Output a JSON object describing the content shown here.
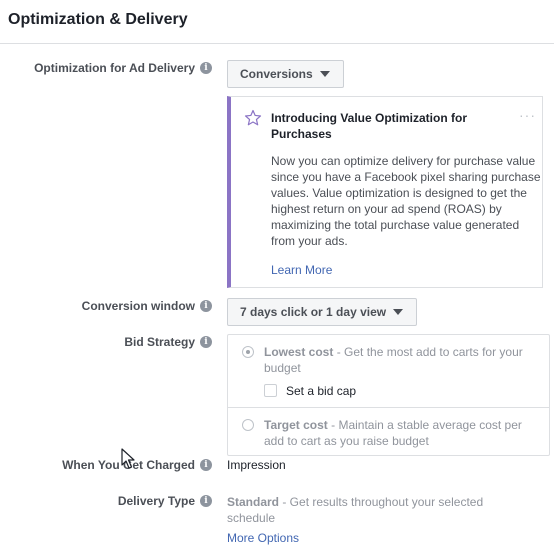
{
  "header": {
    "title": "Optimization & Delivery"
  },
  "optimization": {
    "label": "Optimization for Ad Delivery",
    "value": "Conversions"
  },
  "callout": {
    "title": "Introducing Value Optimization for Purchases",
    "body": "Now you can optimize delivery for purchase value since you have a Facebook pixel sharing purchase values. Value optimization is designed to get the highest return on your ad spend (ROAS) by maximizing the total purchase value generated from your ads.",
    "link": "Learn More",
    "more": "···",
    "icon": "star-icon"
  },
  "conversion_window": {
    "label": "Conversion window",
    "value": "7 days click or 1 day view"
  },
  "bid_strategy": {
    "label": "Bid Strategy",
    "options": [
      {
        "title": "Lowest cost",
        "desc": " - Get the most add to carts for your budget",
        "checked": true
      },
      {
        "title": "Target cost",
        "desc": " - Maintain a stable average cost per add to cart as you raise budget",
        "checked": false
      }
    ],
    "bid_cap_label": "Set a bid cap"
  },
  "charged": {
    "label": "When You Get Charged",
    "value": "Impression"
  },
  "delivery_type": {
    "label": "Delivery Type",
    "title": "Standard",
    "desc": " - Get results throughout your selected schedule",
    "more_options": "More Options"
  },
  "info_glyph": "i"
}
